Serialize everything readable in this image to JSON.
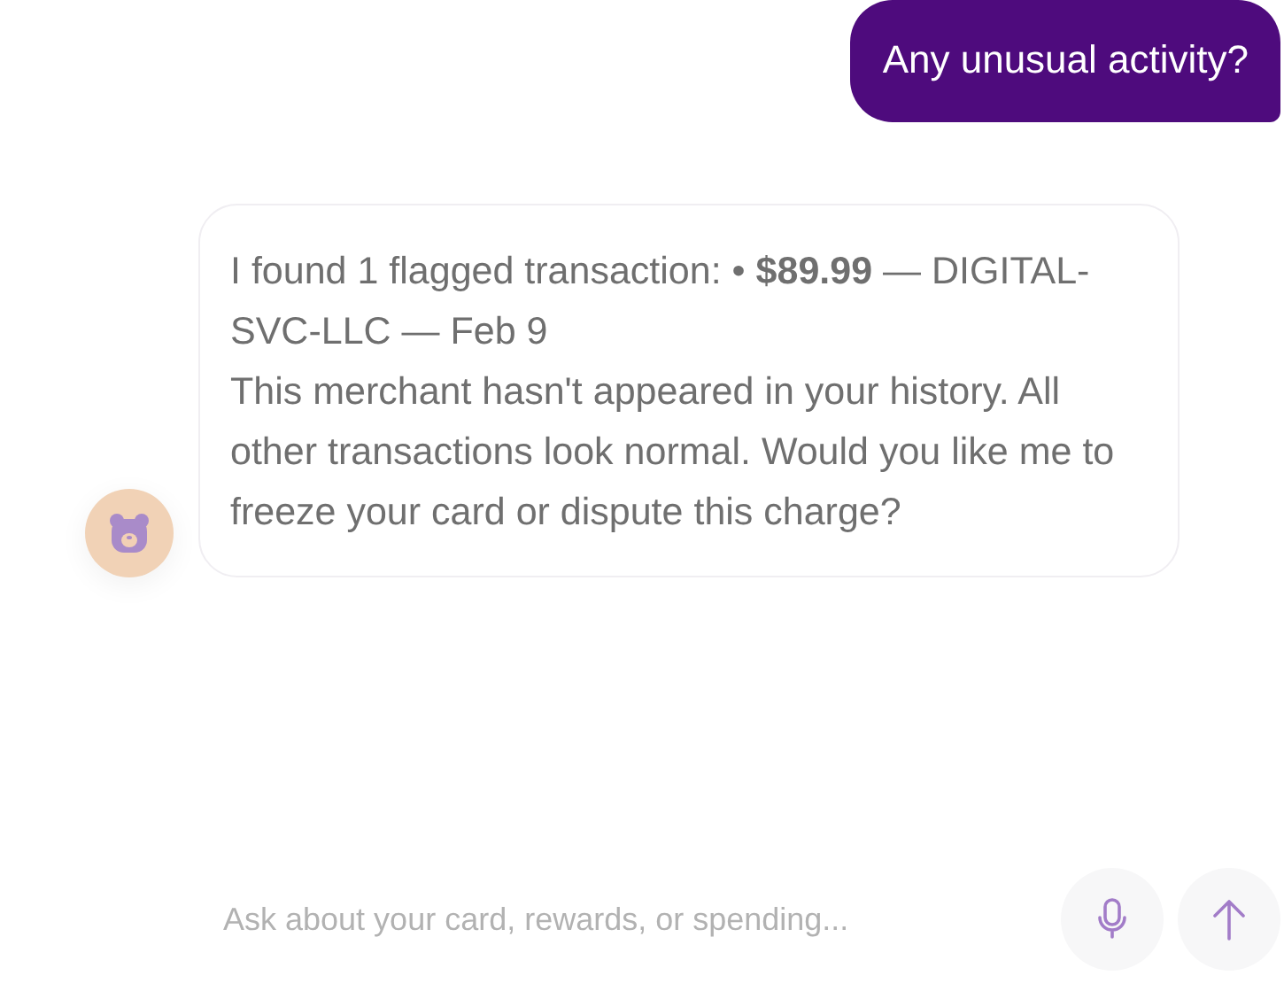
{
  "messages": [
    {
      "kind": "user",
      "text": "Any unusual activity?"
    },
    {
      "kind": "assistant",
      "text": "I found 1 flagged transaction: • **$89.99** — DIGITAL-SVC-LLC — Feb 9\nThis merchant hasn't appeared in your history. All other transactions look normal. Would you like me to freeze your card or dispute this charge?"
    }
  ],
  "composer": {
    "placeholder": "Ask about your card, rewards, or spending..."
  }
}
